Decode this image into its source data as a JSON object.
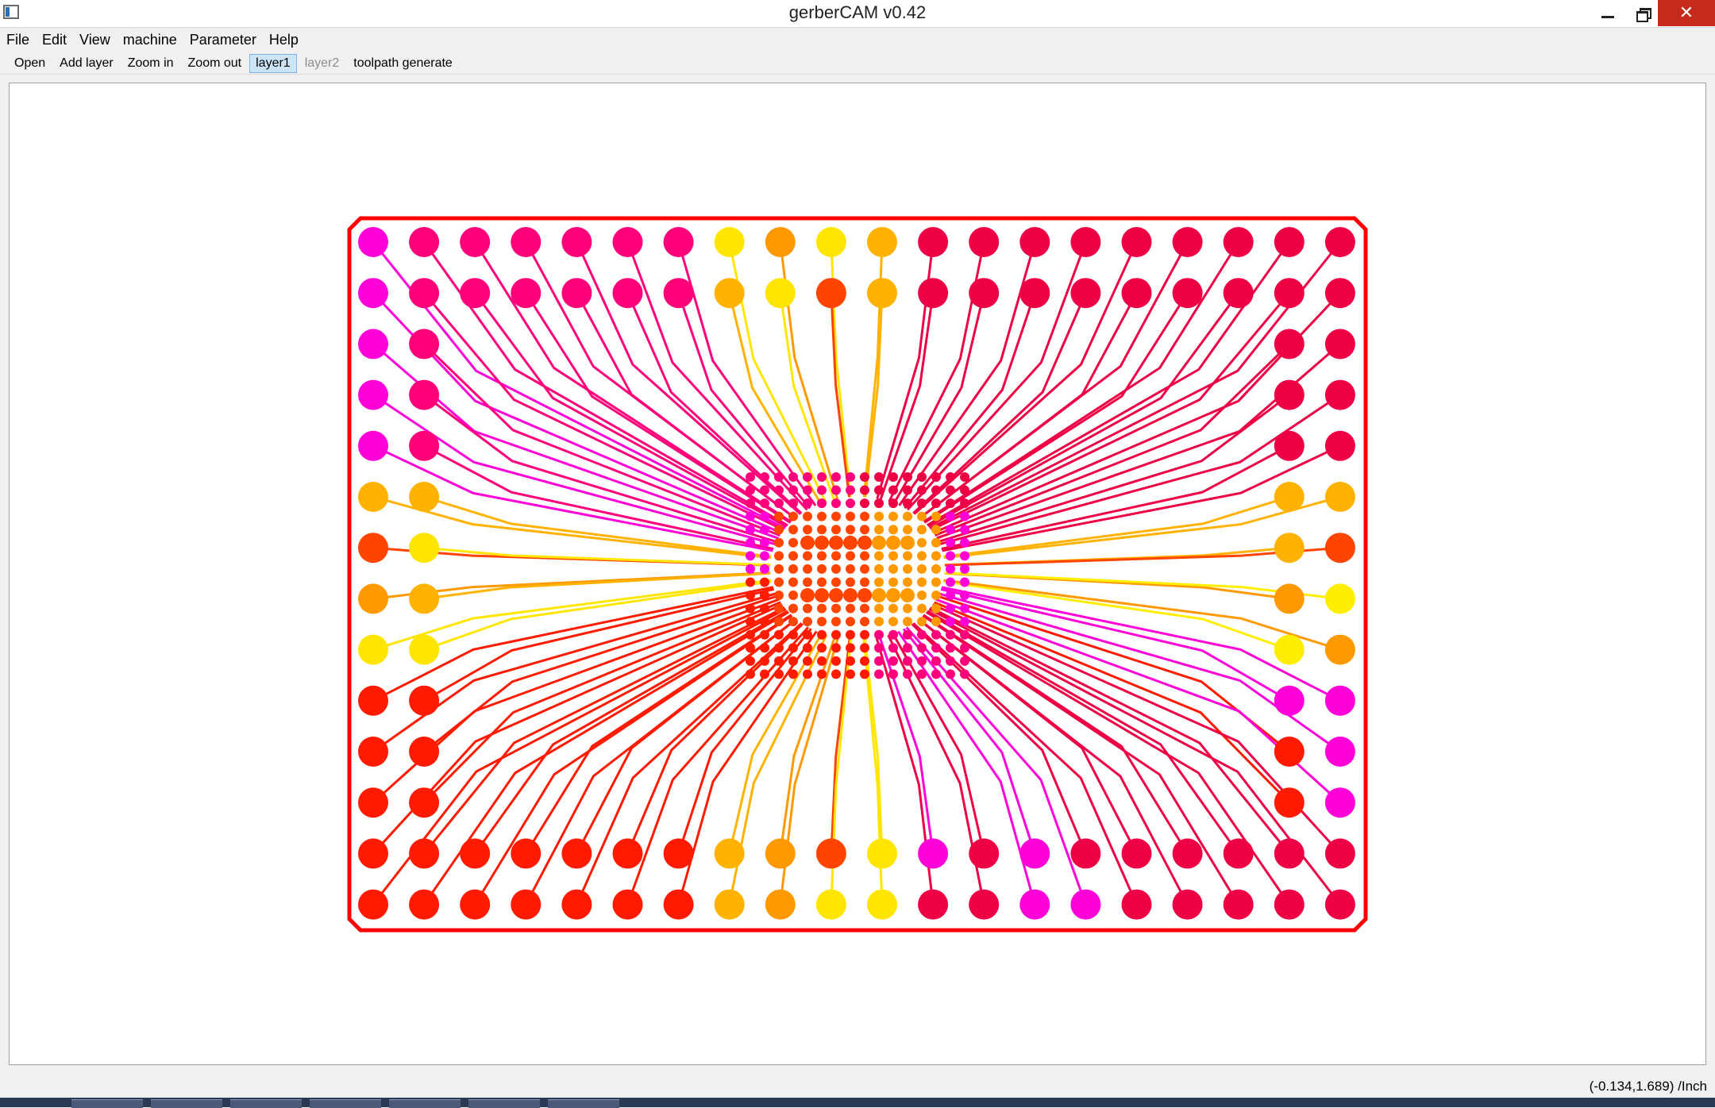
{
  "window": {
    "title": "gerberCAM v0.42",
    "controls": {
      "minimize": "minimize",
      "maximize": "restore",
      "close": "✕"
    }
  },
  "menu": [
    "File",
    "Edit",
    "View",
    "machine",
    "Parameter",
    "Help"
  ],
  "toolbar": [
    {
      "label": "Open",
      "state": "normal"
    },
    {
      "label": "Add layer",
      "state": "normal"
    },
    {
      "label": "Zoom in",
      "state": "normal"
    },
    {
      "label": "Zoom out",
      "state": "normal"
    },
    {
      "label": "layer1",
      "state": "checked"
    },
    {
      "label": "layer2",
      "state": "disabled"
    },
    {
      "label": "toolpath generate",
      "state": "normal"
    }
  ],
  "status": {
    "coordinates": "(-0.134,1.689) /Inch"
  },
  "colors": {
    "outline": "#ff0000",
    "magenta": "#ff00d8",
    "pink": "#ff007a",
    "crimson": "#ee0044",
    "red": "#ff1a00",
    "orange_red": "#ff4400",
    "orange": "#ff9900",
    "amber": "#ffb300",
    "yellow": "#ffe600",
    "bright_yellow": "#ffee00",
    "close_button": "#c42b1c",
    "selection": "#cce4f7"
  }
}
